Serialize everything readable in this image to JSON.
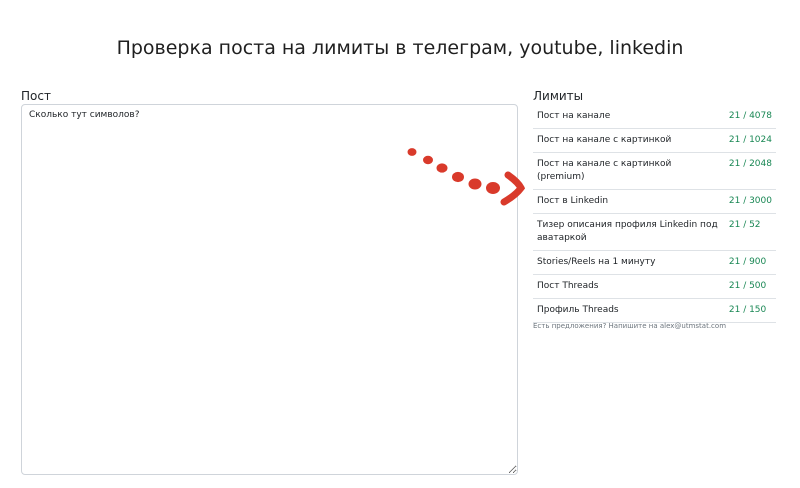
{
  "header": {
    "title": "Проверка поста на лимиты в телеграм, youtube, linkedin"
  },
  "post": {
    "label": "Пост",
    "value": "Сколько тут символов?"
  },
  "limits": {
    "label": "Лимиты",
    "rows": [
      {
        "name": "Пост на канале",
        "value": "21 / 4078"
      },
      {
        "name": "Пост на канале с картинкой",
        "value": "21 / 1024"
      },
      {
        "name": "Пост на канале с картинкой (premium)",
        "value": "21 / 2048"
      },
      {
        "name": "Пост в Linkedin",
        "value": "21 / 3000"
      },
      {
        "name": "Тизер описания профиля Linkedin под аватаркой",
        "value": "21 / 52"
      },
      {
        "name": "Stories/Reels на 1 минуту",
        "value": "21 / 900"
      },
      {
        "name": "Пост Threads",
        "value": "21 / 500"
      },
      {
        "name": "Профиль Threads",
        "value": "21 / 150"
      }
    ],
    "footer": "Есть предложения? Напишите на alex@utmstat.com"
  },
  "colors": {
    "value_green": "#198754",
    "arrow_red": "#d93a2b"
  }
}
